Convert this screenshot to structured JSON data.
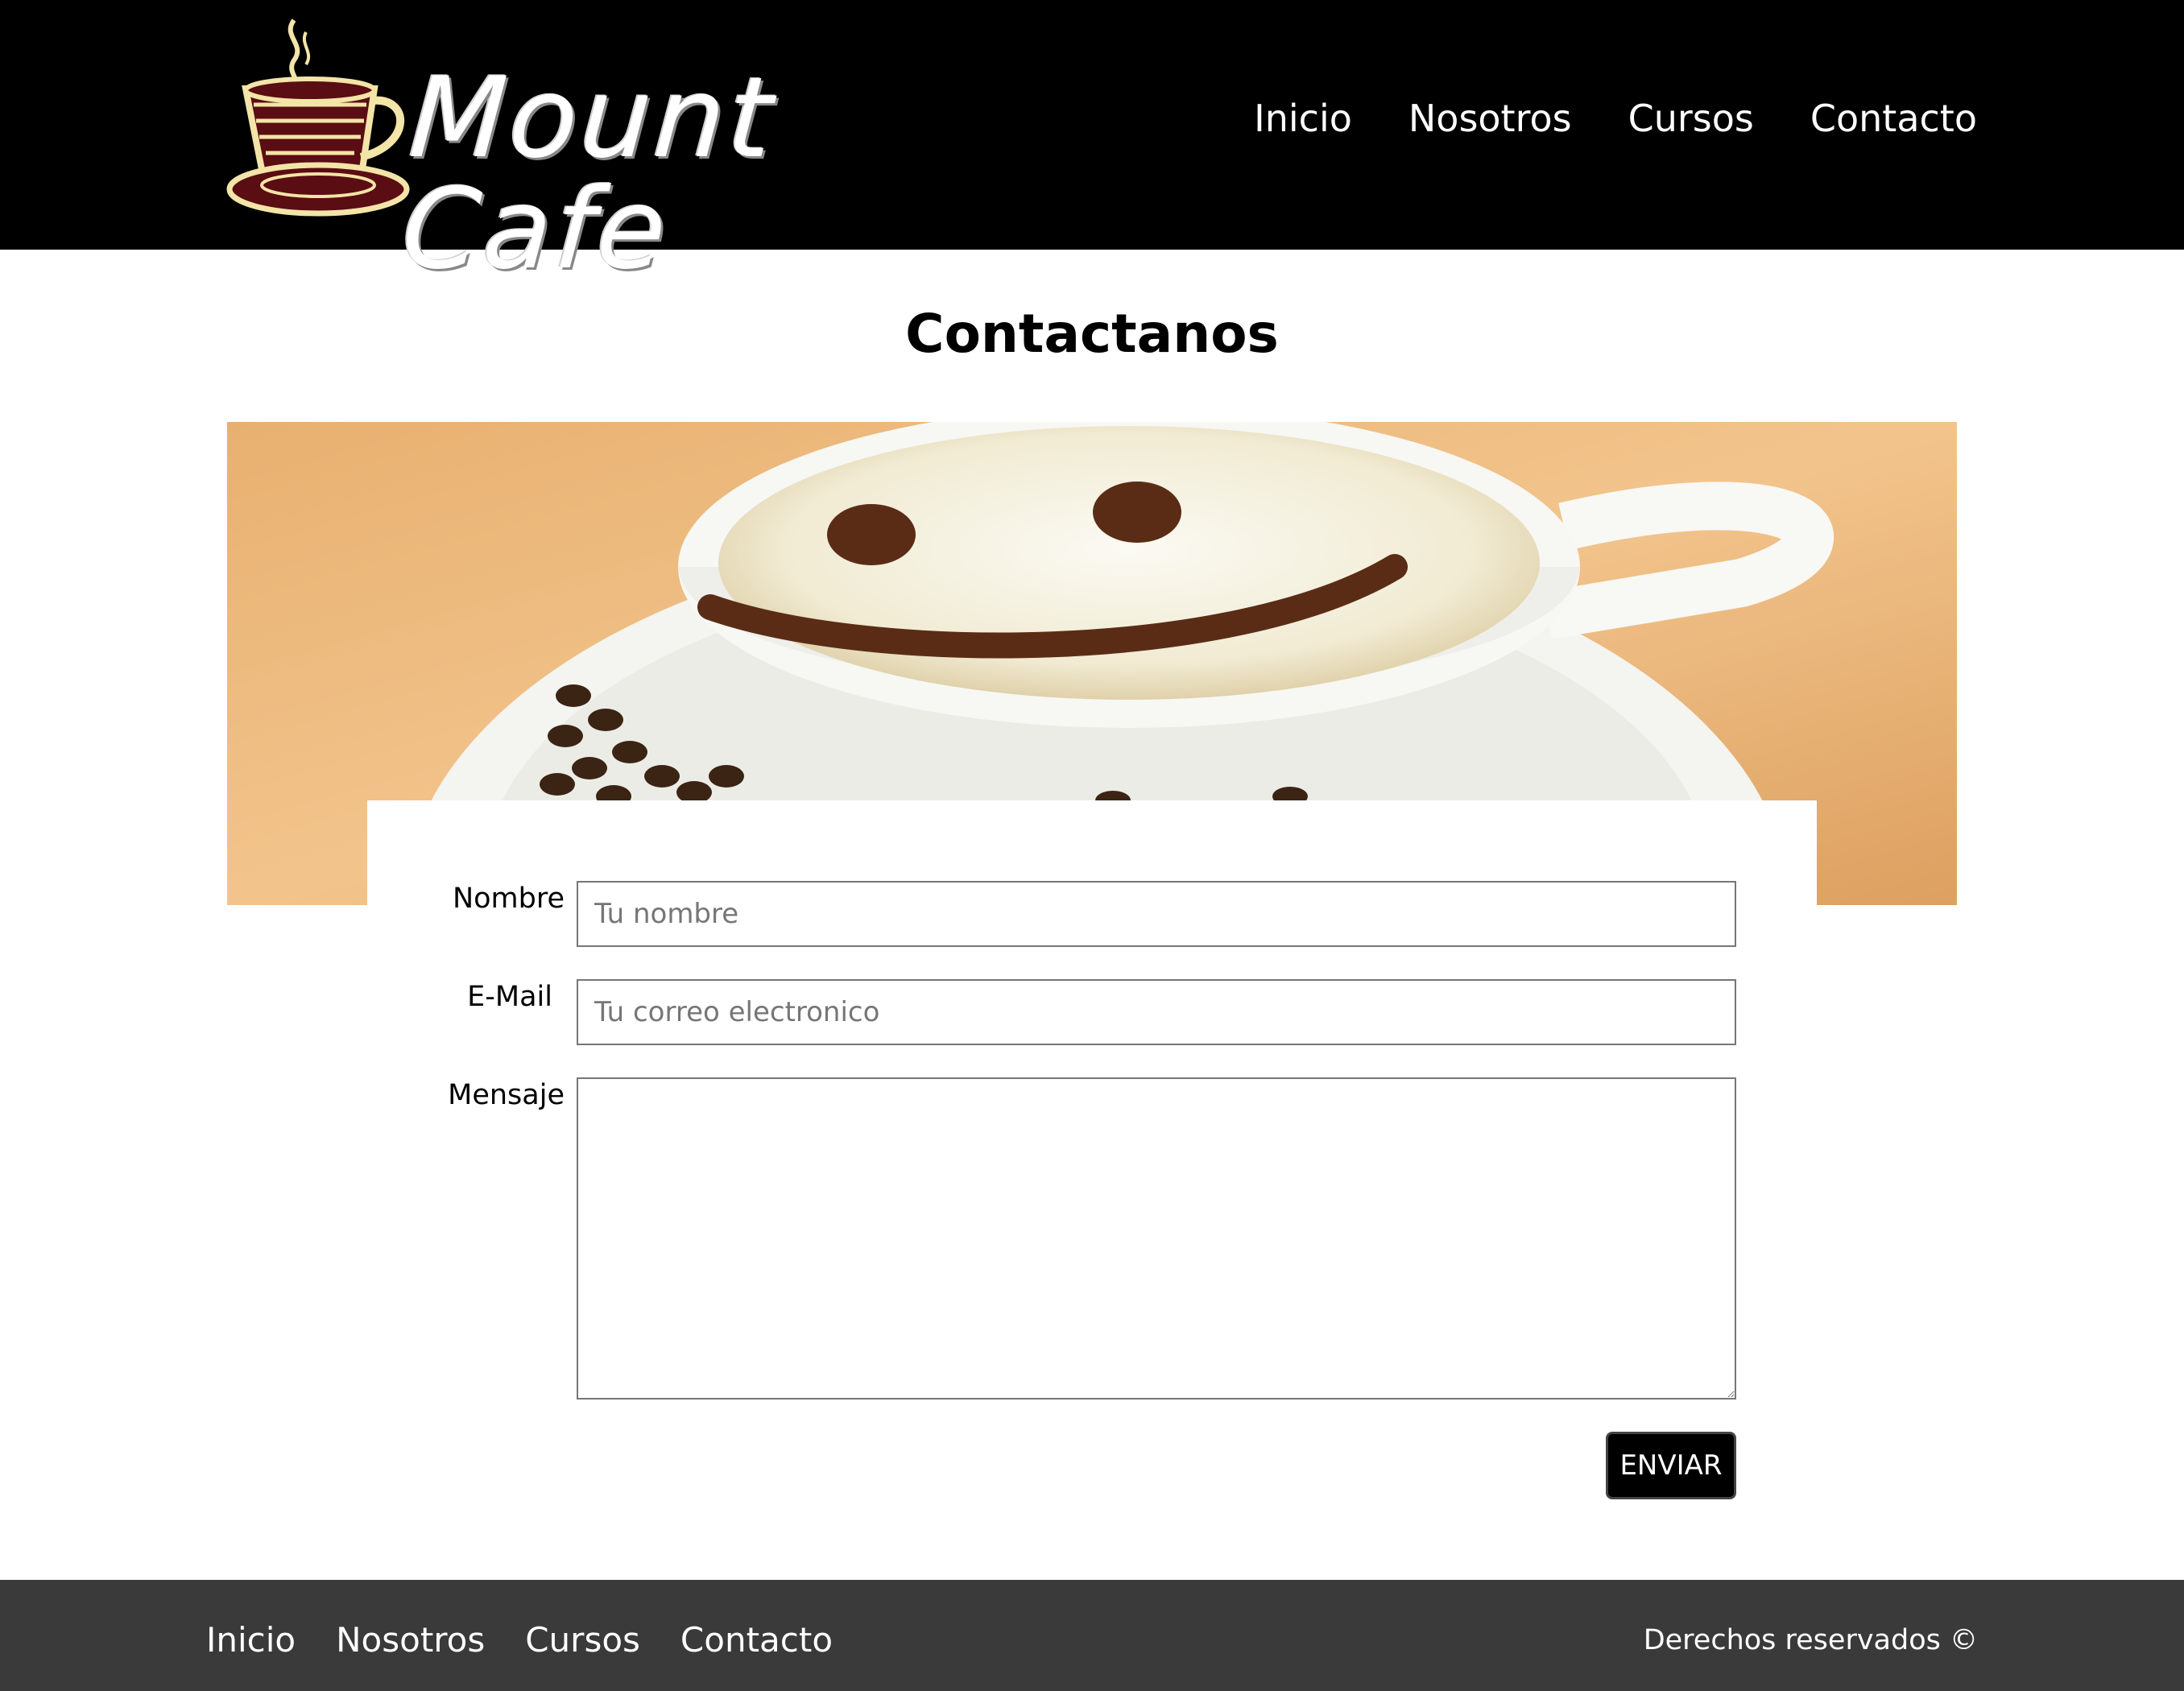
{
  "header": {
    "logo_text": "Mount Cafe",
    "nav": [
      {
        "label": "Inicio"
      },
      {
        "label": "Nosotros"
      },
      {
        "label": "Cursos"
      },
      {
        "label": "Contacto"
      }
    ]
  },
  "main": {
    "title": "Contactanos",
    "form": {
      "name_label": "Nombre",
      "name_placeholder": "Tu nombre",
      "email_label": "E-Mail",
      "email_placeholder": "Tu correo electronico",
      "message_label": "Mensaje",
      "message_value": "",
      "submit_label": "ENVIAR"
    }
  },
  "footer": {
    "nav": [
      {
        "label": "Inicio"
      },
      {
        "label": "Nosotros"
      },
      {
        "label": "Cursos"
      },
      {
        "label": "Contacto"
      }
    ],
    "copyright": "Derechos reservados ©"
  },
  "colors": {
    "header_bg": "#000000",
    "footer_bg": "#3a3a3a",
    "button_bg": "#000000",
    "logo_cup": "#f3e4a8"
  },
  "icons": {
    "logo": "coffee-cup-icon",
    "hero": "latte-smiley-image"
  }
}
